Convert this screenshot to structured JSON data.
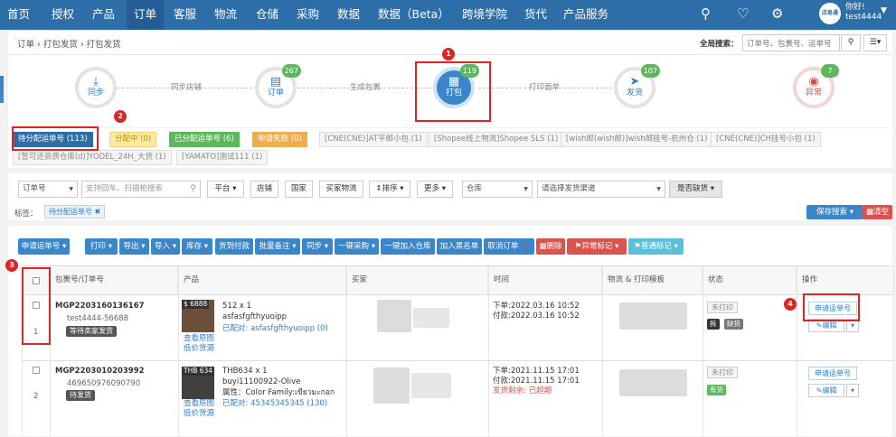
{
  "topnav": {
    "items": [
      "首页",
      "授权",
      "产品",
      "订单",
      "客服",
      "物流",
      "仓储",
      "采购",
      "数据",
      "数据（Beta）",
      "跨境学院",
      "货代",
      "产品服务"
    ],
    "user_greeting": "你好!",
    "username": "test4444",
    "avatar_text": "店易通"
  },
  "breadcrumb": "订单 › 打包发货 › 打包发货",
  "global_search": {
    "label": "全局搜索：",
    "placeholder": "订单号、包裹号、运单号"
  },
  "steps": [
    {
      "label": "同步",
      "badge": ""
    },
    {
      "label": "订单",
      "badge": "267"
    },
    {
      "label": "打包",
      "badge": "119"
    },
    {
      "label": "发货",
      "badge": "107"
    },
    {
      "label": "异常",
      "badge": "7"
    }
  ],
  "step_connectors": [
    "同步店铺",
    "生成包裹",
    "打印面单"
  ],
  "status_tabs": [
    "待分配运单号 (113)",
    "分配中 (0)",
    "已分配运单号 (6)",
    "申请失败 (0)",
    "[CNE(CNE)]AT平邮小包 (1)",
    "[Shopee线上物流]Shopee SLS (1)",
    "[wish邮(wish邮)]wish邮挂号-杭州仓 (1)",
    "[CNE(CNE)]CH挂号小包 (1)",
    "[暂可还资质仓库(d)]YODEL_24H_大货 (1)",
    "[YAMATO]测试111 (1)"
  ],
  "filters": {
    "order_no": "订单号",
    "search_placeholder": "支持回车、扫描枪搜索",
    "platform": "平台",
    "store": "店铺",
    "country": "国家",
    "buyer_logistics": "买家物流",
    "sort": "排序",
    "more": "更多",
    "warehouse": "仓库",
    "channel": "请选择发货渠道",
    "out_of_stock": "是否缺货",
    "tag_label": "标签：",
    "tag_value": "待分配运单号",
    "save_search": "保存搜索",
    "clear": "清空"
  },
  "toolbar": [
    "申请运单号",
    "打印",
    "导出",
    "导入",
    "库存",
    "货到付款",
    "批量备注",
    "同步",
    "一键采购",
    "一键加入仓库",
    "加入黑名单",
    "取消订单",
    "删除",
    "异常标记",
    "普通标记"
  ],
  "table": {
    "headers": [
      "包裹号/订单号",
      "产品",
      "买家",
      "时间",
      "物流 & 打印模板",
      "状态",
      "操作"
    ],
    "rows": [
      {
        "index": "1",
        "package_no": "MGP2203160136167",
        "order_no": "test4444-56688",
        "badge": "等待卖家发货",
        "thumb_label": "$ 6888",
        "product_line1": "512 x 1",
        "product_line2": "asfasfgfthyuoipp",
        "view_image": "查看原图",
        "low_price": "低价货源",
        "matched": "已配对: asfasfgfthyuoipp (0)",
        "time_order": "下单:2022.03.16 10:52",
        "time_paid": "付款:2022.03.16 10:52",
        "time_extra": "",
        "status_tag": "未打印",
        "mini_tags": [
          "拆",
          "缺货"
        ],
        "action_primary": "申请运单号",
        "action_edit": "编辑"
      },
      {
        "index": "2",
        "package_no": "MGP2203010203992",
        "order_no": "469650976090790",
        "badge": "待发货",
        "thumb_label": "THB 634",
        "product_line1": "THB634 x 1",
        "product_line2": "buyi11100922-Olive",
        "product_attr": "属性：Color Family:เขียวมะกอก",
        "view_image": "查看原图",
        "low_price": "低价货源",
        "matched": "已配对: 45345345345 (130)",
        "time_order": "下单:2021.11.15 17:01",
        "time_paid": "付款:2021.11.15 17:01",
        "time_extra": "发货剩余: 已超期",
        "status_tag": "未打印",
        "mini_tags": [
          "有货"
        ],
        "action_primary": "申请运单号",
        "action_edit": "编辑"
      }
    ]
  },
  "annotations": [
    "1",
    "2",
    "3",
    "4"
  ],
  "colors": {
    "nav": "#2d6ea8",
    "primary": "#3a86c8",
    "danger": "#d9534f",
    "highlight": "#e02424"
  }
}
